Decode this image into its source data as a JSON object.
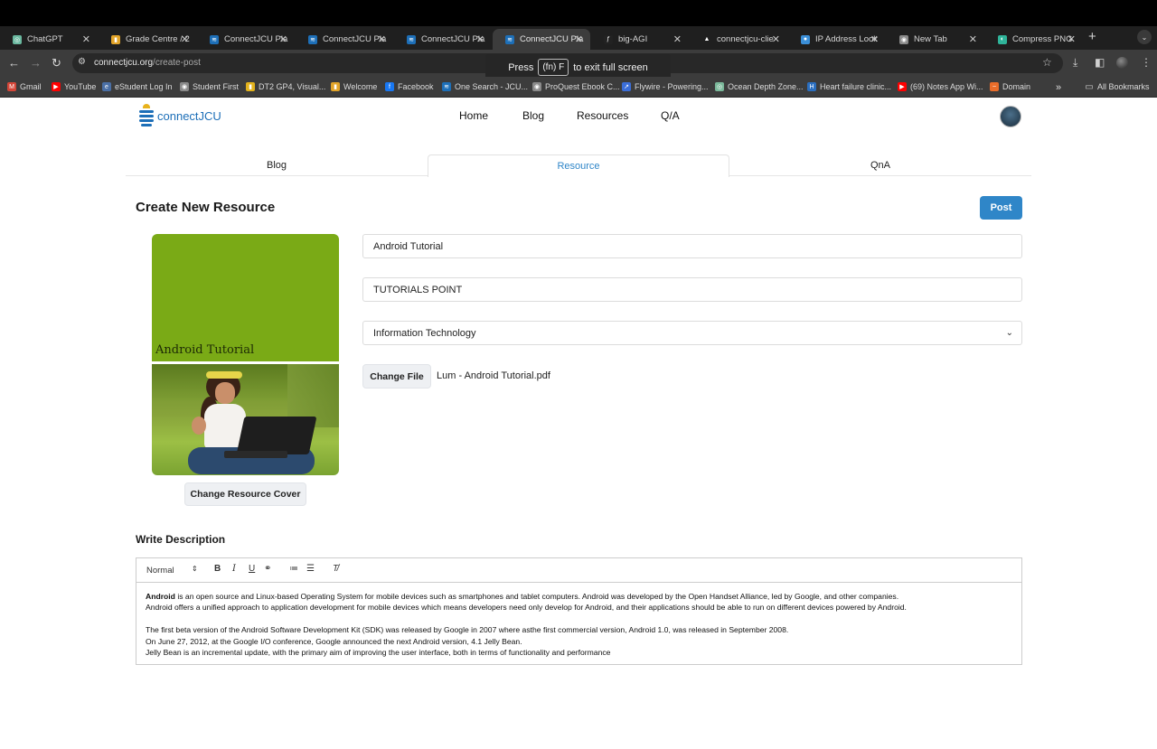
{
  "browser": {
    "tabs": [
      {
        "label": "ChatGPT",
        "color": "#6bb9a0",
        "glyph": "◎"
      },
      {
        "label": "Grade Centre / 2",
        "color": "#e2a429",
        "glyph": "▮"
      },
      {
        "label": "ConnectJCU Pla",
        "color": "#1d6fb8",
        "glyph": "≋"
      },
      {
        "label": "ConnectJCU Pla",
        "color": "#1d6fb8",
        "glyph": "≋"
      },
      {
        "label": "ConnectJCU Pla",
        "color": "#1d6fb8",
        "glyph": "≋"
      },
      {
        "label": "ConnectJCU Pla",
        "color": "#1d6fb8",
        "glyph": "≋"
      },
      {
        "label": "big-AGI",
        "color": "#222222",
        "glyph": "ƒ"
      },
      {
        "label": "connectjcu-clie",
        "color": "#ffffff",
        "glyph": "▲"
      },
      {
        "label": "IP Address Look",
        "color": "#3b8fd8",
        "glyph": "●"
      },
      {
        "label": "New Tab",
        "color": "#8a8a8a",
        "glyph": "◉"
      },
      {
        "label": "Compress PNG",
        "color": "#2fb49a",
        "glyph": "◐"
      }
    ],
    "url_host": "connectjcu.org",
    "url_path": "/create-post",
    "fullscreen_tip": {
      "press": "Press",
      "key": "(fn) F",
      "suffix": "to exit full screen"
    },
    "bookmarks": [
      {
        "label": "Gmail",
        "color": "#d44638",
        "glyph": "M"
      },
      {
        "label": "YouTube",
        "color": "#ff0000",
        "glyph": "▶"
      },
      {
        "label": "eStudent Log In",
        "color": "#4a6fa5",
        "glyph": "e"
      },
      {
        "label": "Student First",
        "color": "#8a8a8a",
        "glyph": "◉"
      },
      {
        "label": "DT2 GP4, Visual...",
        "color": "#e2b21c",
        "glyph": "▮"
      },
      {
        "label": "Welcome",
        "color": "#e2a429",
        "glyph": "▮"
      },
      {
        "label": "Facebook",
        "color": "#1877f2",
        "glyph": "f"
      },
      {
        "label": "One Search - JCU...",
        "color": "#1d6fb8",
        "glyph": "≋"
      },
      {
        "label": "ProQuest Ebook C...",
        "color": "#8a8a8a",
        "glyph": "◉"
      },
      {
        "label": "Flywire - Powering...",
        "color": "#3b6ed8",
        "glyph": "↗"
      },
      {
        "label": "Ocean Depth Zone...",
        "color": "#7ab89a",
        "glyph": "◎"
      },
      {
        "label": "Heart failure clinic...",
        "color": "#2a6ebf",
        "glyph": "H"
      },
      {
        "label": "(69) Notes App Wi...",
        "color": "#ff0000",
        "glyph": "▶"
      },
      {
        "label": "Domain",
        "color": "#e96d2a",
        "glyph": "~"
      }
    ],
    "all_bookmarks": "All Bookmarks"
  },
  "site": {
    "logo_text": "connectJCU",
    "nav": {
      "home": "Home",
      "blog": "Blog",
      "resources": "Resources",
      "qa": "Q/A"
    },
    "subtabs": {
      "blog": "Blog",
      "resource": "Resource",
      "qna": "QnA"
    }
  },
  "form": {
    "page_title": "Create New Resource",
    "post_label": "Post",
    "cover_title": "Android Tutorial",
    "change_cover_label": "Change Resource Cover",
    "title_value": "Android Tutorial",
    "author_value": "TUTORIALS POINT",
    "category_value": "Information Technology",
    "change_file_label": "Change File",
    "file_name": "Lum - Android Tutorial.pdf",
    "description_heading": "Write Description"
  },
  "editor": {
    "format_value": "Normal",
    "bold_glyph": "B",
    "italic_glyph": "I",
    "underline_glyph": "U",
    "p1_bold": "Android",
    "p1_rest": " is an open source and Linux-based Operating System for mobile devices such as smartphones and tablet computers. Android was developed by the Open Handset Alliance, led by Google, and other companies.",
    "p2": "Android offers a unified approach to application development for mobile devices which means developers need only develop for Android, and their applications should be able to run on different devices powered by Android.",
    "p3": "The first beta version of the Android Software Development Kit (SDK) was released by Google in 2007 where asthe first commercial version, Android 1.0, was released in September 2008.",
    "p4": "On June 27, 2012, at the Google I/O conference, Google announced the next Android version, 4.1 Jelly Bean.",
    "p5": "Jelly Bean is an incremental update, with the primary aim of improving the user interface, both in terms of functionality and performance"
  }
}
